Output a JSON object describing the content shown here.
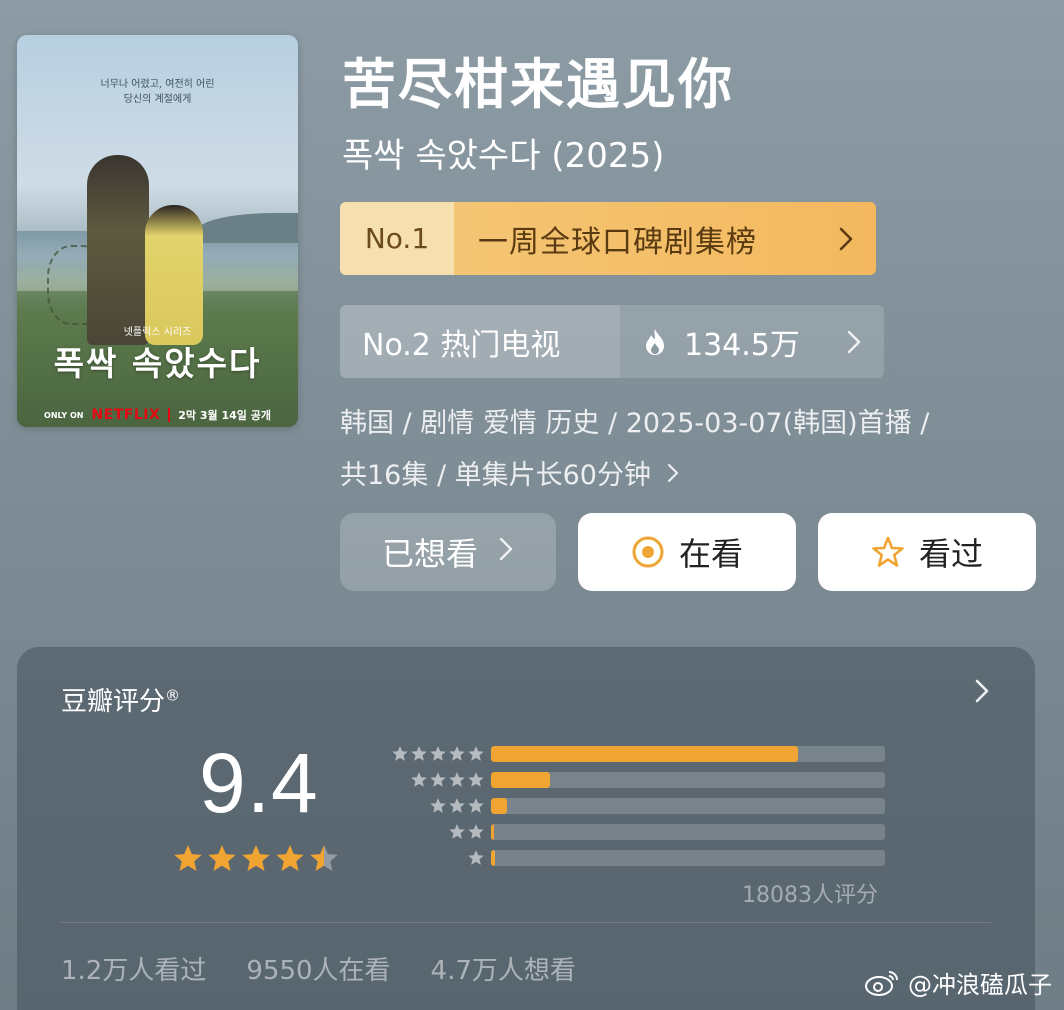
{
  "poster": {
    "tagline_line1": "너무나 어렸고, 여전히 어린",
    "tagline_line2": "당신의 계절에게",
    "series_label": "넷플릭스 시리즈",
    "title": "폭싹 속았수다",
    "only_on": "ONLY ON",
    "brand": "NETFLIX",
    "release": "2막 3월 14일 공개"
  },
  "header": {
    "title": "苦尽柑来遇见你",
    "subtitle": "폭싹 속았수다 (2025)"
  },
  "rank1": {
    "number": "No.1",
    "label": "一周全球口碑剧集榜",
    "icon": "chevron-right-icon"
  },
  "rank2": {
    "number": "No.2 热门电视",
    "heat": "134.5万",
    "icon": "flame-icon"
  },
  "meta": {
    "line1": "韩国 / 剧情 爱情 历史 / 2025-03-07(韩国)首播 /",
    "line2": "共16集 / 单集片长60分钟"
  },
  "actions": {
    "wished": "已想看",
    "watching": "在看",
    "watched": "看过"
  },
  "rating": {
    "title": "豆瓣评分",
    "registered": "®",
    "score": "9.4",
    "stars": 4.5,
    "distribution": [
      {
        "stars": 5,
        "fraction": 0.78
      },
      {
        "stars": 4,
        "fraction": 0.15
      },
      {
        "stars": 3,
        "fraction": 0.04
      },
      {
        "stars": 2,
        "fraction": 0.005
      },
      {
        "stars": 1,
        "fraction": 0.01
      }
    ],
    "count": "18083人评分",
    "stats": [
      "1.2万人看过",
      "9550人在看",
      "4.7万人想看"
    ]
  },
  "watermark": {
    "text": "@冲浪磕瓜子",
    "icon": "weibo-icon"
  },
  "colors": {
    "accent": "#f0a432",
    "rank1_bg": "#f3b85e",
    "rank1_badge": "#f7e0b0",
    "background": "#8c9ba4"
  }
}
